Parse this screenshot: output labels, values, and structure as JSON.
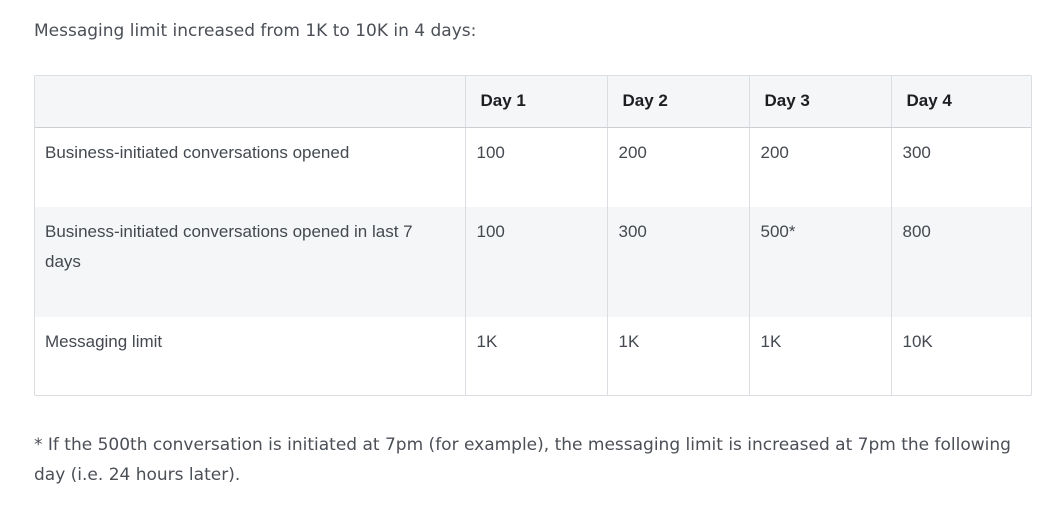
{
  "intro": "Messaging limit increased from 1K to 10K in 4 days:",
  "table": {
    "headers": [
      "",
      "Day 1",
      "Day 2",
      "Day 3",
      "Day 4"
    ],
    "rows": [
      {
        "label": "Business-initiated conversations opened",
        "values": [
          "100",
          "200",
          "200",
          "300"
        ]
      },
      {
        "label": "Business-initiated conversations opened in last 7 days",
        "values": [
          "100",
          "300",
          "500*",
          "800"
        ]
      },
      {
        "label": "Messaging limit",
        "values": [
          "1K",
          "1K",
          "1K",
          "10K"
        ]
      }
    ]
  },
  "footnote": "* If the 500th conversation is initiated at 7pm (for example), the messaging limit is increased at 7pm the following day (i.e. 24 hours later)."
}
